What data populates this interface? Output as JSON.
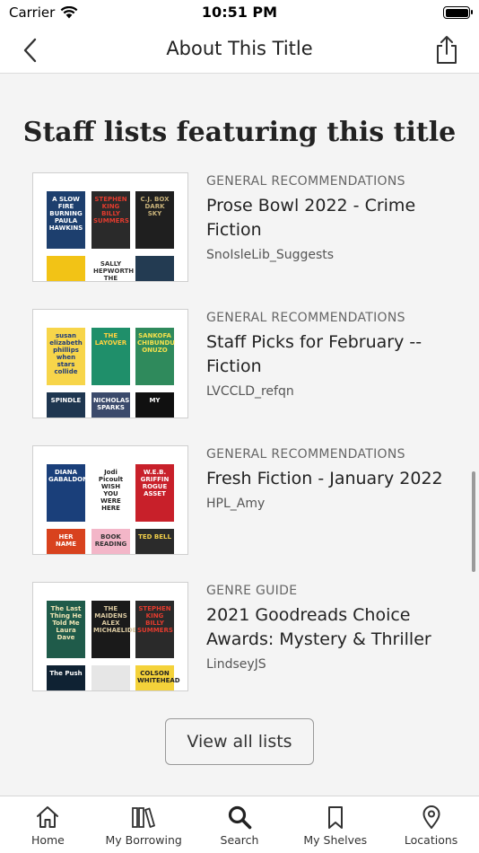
{
  "status_bar": {
    "carrier": "Carrier",
    "time": "10:51 PM"
  },
  "nav": {
    "title": "About This Title"
  },
  "section": {
    "title": "Staff lists featuring this title"
  },
  "lists": [
    {
      "category": "GENERAL RECOMMENDATIONS",
      "title": "Prose Bowl 2022 - Crime Fiction",
      "author": "SnoIsleLib_Suggests",
      "covers": [
        {
          "bg": "#1d3f6e",
          "fg": "#ffffff",
          "text": "A SLOW FIRE BURNING PAULA HAWKINS"
        },
        {
          "bg": "#2a2a2a",
          "fg": "#e23b2e",
          "text": "STEPHEN KING BILLY SUMMERS"
        },
        {
          "bg": "#1f1f1f",
          "fg": "#c8b27a",
          "text": "C.J. BOX DARK SKY"
        },
        {
          "bg": "#f2c316",
          "fg": "#222222",
          "text": ""
        },
        {
          "bg": "#ffffff",
          "fg": "#333333",
          "text": "SALLY HEPWORTH THE"
        },
        {
          "bg": "#233b52",
          "fg": "#ffffff",
          "text": ""
        }
      ]
    },
    {
      "category": "GENERAL RECOMMENDATIONS",
      "title": "Staff Picks for February -- Fiction",
      "author": "LVCCLD_refqn",
      "covers": [
        {
          "bg": "#f7d54a",
          "fg": "#1f3b7a",
          "text": "susan elizabeth phillips when stars collide"
        },
        {
          "bg": "#1f8f6a",
          "fg": "#ffd23f",
          "text": "THE LAYOVER"
        },
        {
          "bg": "#2f8a5c",
          "fg": "#f4e04d",
          "text": "SANKOFA CHIBUNDU ONUZO"
        },
        {
          "bg": "#1e3650",
          "fg": "#ffffff",
          "text": "SPINDLE"
        },
        {
          "bg": "#3b4a6b",
          "fg": "#ffffff",
          "text": "NICHOLAS SPARKS"
        },
        {
          "bg": "#101010",
          "fg": "#ffffff",
          "text": "MY"
        }
      ]
    },
    {
      "category": "GENERAL RECOMMENDATIONS",
      "title": "Fresh Fiction - January 2022",
      "author": "HPL_Amy",
      "covers": [
        {
          "bg": "#1a3f7a",
          "fg": "#ffffff",
          "text": "DIANA GABALDON"
        },
        {
          "bg": "#ffffff",
          "fg": "#222222",
          "text": "Jodi Picoult WISH YOU WERE HERE"
        },
        {
          "bg": "#c8202a",
          "fg": "#ffffff",
          "text": "W.E.B. GRIFFIN ROGUE ASSET"
        },
        {
          "bg": "#d8421e",
          "fg": "#ffffff",
          "text": "HER NAME"
        },
        {
          "bg": "#f3b6c8",
          "fg": "#333333",
          "text": "BOOK READING"
        },
        {
          "bg": "#2b2b2b",
          "fg": "#f3d04a",
          "text": "TED BELL"
        }
      ]
    },
    {
      "category": "GENRE GUIDE",
      "title": "2021 Goodreads Choice Awards: Mystery & Thriller",
      "author": "LindseyJS",
      "covers": [
        {
          "bg": "#1f5b4a",
          "fg": "#f1e6b6",
          "text": "The Last Thing He Told Me Laura Dave"
        },
        {
          "bg": "#1a1a1a",
          "fg": "#d9c8a0",
          "text": "THE MAIDENS ALEX MICHAELIDES"
        },
        {
          "bg": "#2a2a2a",
          "fg": "#e23b2e",
          "text": "STEPHEN KING BILLY SUMMERS"
        },
        {
          "bg": "#0f2233",
          "fg": "#ffffff",
          "text": "The Push"
        },
        {
          "bg": "#e6e6e6",
          "fg": "#c0342a",
          "text": ""
        },
        {
          "bg": "#f4d23a",
          "fg": "#222222",
          "text": "COLSON WHITEHEAD"
        }
      ]
    }
  ],
  "view_all_label": "View all lists",
  "tabs": [
    {
      "label": "Home",
      "icon": "home-icon"
    },
    {
      "label": "My Borrowing",
      "icon": "books-icon"
    },
    {
      "label": "Search",
      "icon": "search-icon"
    },
    {
      "label": "My Shelves",
      "icon": "bookmark-icon"
    },
    {
      "label": "Locations",
      "icon": "location-pin-icon"
    }
  ]
}
